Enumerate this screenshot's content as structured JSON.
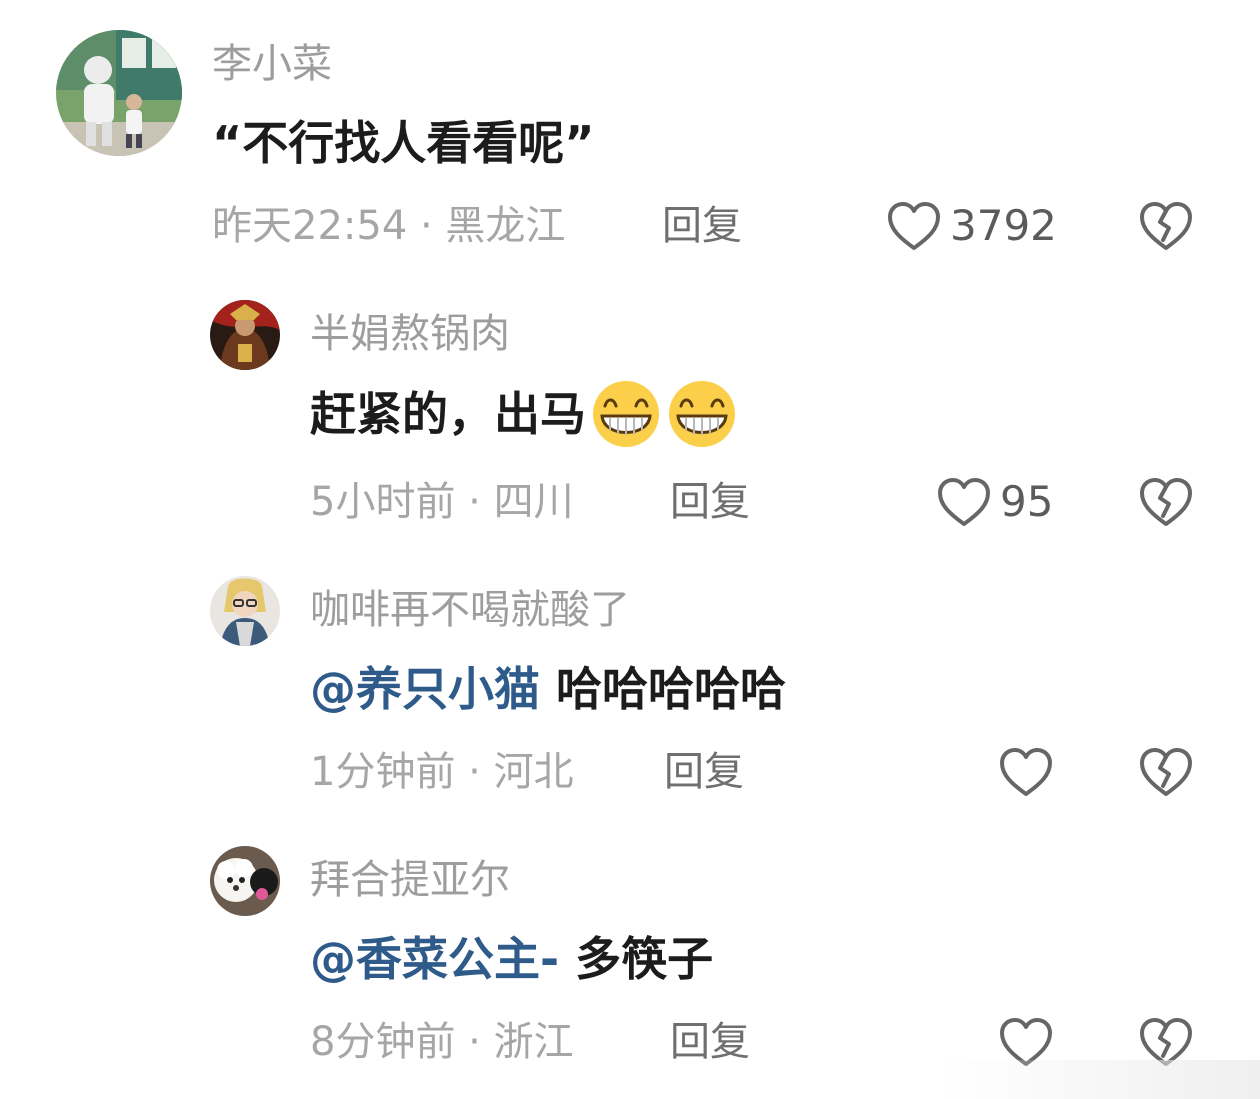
{
  "comments": [
    {
      "username": "李小菜",
      "text": "“不行找人看看呢”",
      "meta": "昨天22:54 · 黑龙江",
      "reply_label": "回复",
      "like_count": "3792"
    },
    {
      "username": "半娟熬锅肉",
      "text": "赶紧的，出马",
      "emoji": "grinning-face-emoji",
      "meta": "5小时前 · 四川",
      "reply_label": "回复",
      "like_count": "95"
    },
    {
      "username": "咖啡再不喝就酸了",
      "mention": "@养只小猫",
      "text": " 哈哈哈哈哈",
      "meta": "1分钟前 · 河北",
      "reply_label": "回复",
      "like_count": ""
    },
    {
      "username": "拜合提亚尔",
      "mention": "@香菜公主-",
      "text": " 多筷子",
      "meta": "8分钟前 · 浙江",
      "reply_label": "回复",
      "like_count": ""
    }
  ],
  "icons": {
    "like": "heart-outline-icon",
    "dislike": "broken-heart-outline-icon"
  },
  "colors": {
    "mention": "#2f5b8a",
    "meta": "#a6a6a6",
    "username": "#9d9d9d"
  }
}
